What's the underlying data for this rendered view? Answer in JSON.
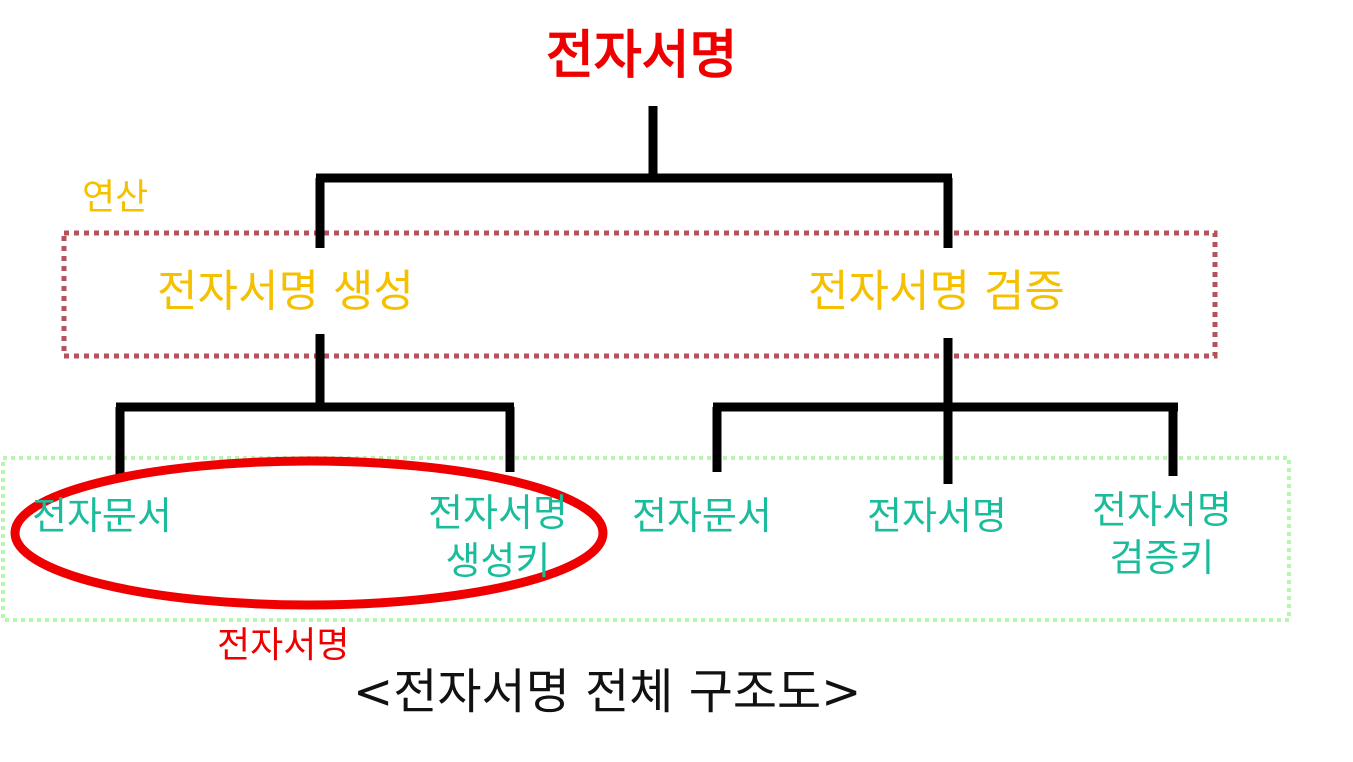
{
  "diagram": {
    "root": "전자서명",
    "operations_label": "연산",
    "operations": {
      "generate": "전자서명 생성",
      "verify": "전자서명 검증"
    },
    "generate_inputs": {
      "document": "전자문서",
      "key_line1": "전자서명",
      "key_line2": "생성키"
    },
    "verify_inputs": {
      "document": "전자문서",
      "signature": "전자서명",
      "key_line1": "전자서명",
      "key_line2": "검증키"
    },
    "circled_label": "전자서명",
    "caption": "<전자서명 전체 구조도>"
  },
  "colors": {
    "root": "#ee0000",
    "operations": "#f5c000",
    "operations_box": "#b5525c",
    "inputs": "#1abc9c",
    "inputs_box": "#b8f5b0",
    "highlight": "#ee0000",
    "lines": "#000000"
  }
}
